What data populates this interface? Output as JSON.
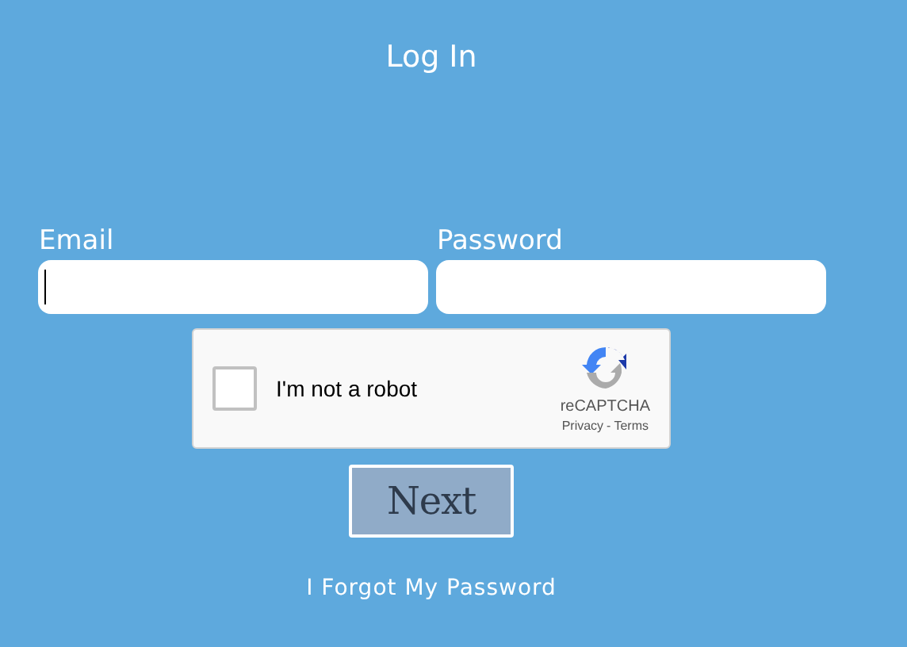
{
  "title": "Log In",
  "fields": [
    {
      "label": "Email",
      "focused": true
    },
    {
      "label": "Password",
      "focused": false
    }
  ],
  "captcha": {
    "label": "I'm not a robot",
    "checked": false,
    "brand": "reCAPTCHA",
    "privacy": "Privacy",
    "separator": "-",
    "terms": "Terms"
  },
  "next_button": "Next",
  "forgot_link": "I Forgot My Password"
}
